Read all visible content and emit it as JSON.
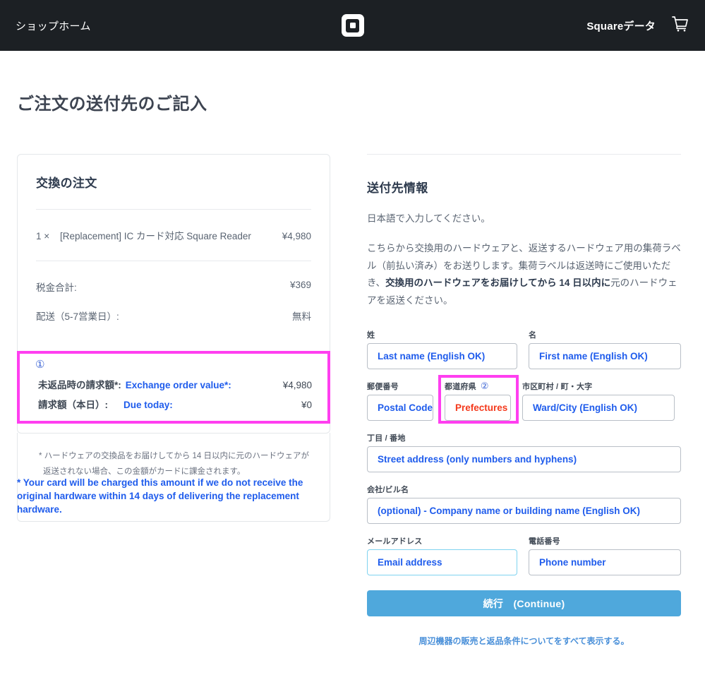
{
  "header": {
    "shop_home_label": "ショップホーム",
    "logo_name": "square-logo",
    "account_label": "Squareデータ",
    "cart_name": "cart-icon"
  },
  "page": {
    "title": "ご注文の送付先のご記入"
  },
  "order_summary": {
    "title": "交換の注文",
    "items": [
      {
        "qty": "1 ×",
        "name": "[Replacement] IC カード対応 Square Reader",
        "price": "¥4,980"
      }
    ],
    "totals": [
      {
        "label": "税金合計:",
        "value": "¥369"
      },
      {
        "label": "配送（5-7営業日）:",
        "value": "無料"
      }
    ],
    "highlight": {
      "marker": "①",
      "rows": [
        {
          "label_jp": "未返品時の請求額*:",
          "label_en": "Exchange order value*:",
          "amount": "¥4,980"
        },
        {
          "label_jp": "請求額（本日）:",
          "label_en": "Due today:",
          "amount": "¥0"
        }
      ]
    },
    "footnote_jp": "* ハードウェアの交換品をお届けしてから 14 日以内に元のハードウェアが返送されない場合、この金額がカードに課金されます。",
    "footnote_en": "* Your card will be charged this amount if we do not receive the original hardware within 14 days of delivering the replacement hardware."
  },
  "shipping": {
    "section_title": "送付先情報",
    "note": "日本語で入力してください。",
    "paragraph_part1": "こちらから交換用のハードウェアと、返送するハードウェア用の集荷ラベル（前払い済み）をお送りします。集荷ラベルは返送時にご使用いただき、",
    "paragraph_bold": "交換用のハードウェアをお届けしてから 14 日以内に",
    "paragraph_part2": "元のハードウェアを返送ください。",
    "fields": {
      "last_name": {
        "label": "姓",
        "placeholder": "Last name (English OK)"
      },
      "first_name": {
        "label": "名",
        "placeholder": "First name (English OK)"
      },
      "postal_code": {
        "label": "郵便番号",
        "placeholder": "Postal Code"
      },
      "prefecture": {
        "label": "都道府県",
        "marker": "②",
        "placeholder": "Prefectures"
      },
      "ward_city": {
        "label": "市区町村 / 町・大字",
        "placeholder": "Ward/City (English OK)"
      },
      "street": {
        "label": "丁目 / 番地",
        "placeholder": "Street address (only numbers and hyphens)"
      },
      "company": {
        "label": "会社/ビル名",
        "placeholder": "(optional) - Company name or building name (English OK)"
      },
      "email": {
        "label": "メールアドレス",
        "placeholder": "Email address"
      },
      "phone": {
        "label": "電話番号",
        "placeholder": "Phone number"
      }
    },
    "continue_button": "続行　(Continue)",
    "terms_link": "周辺機器の販売と返品条件についてをすべて表示する。"
  },
  "colors": {
    "header_bg": "#1c2024",
    "highlight_magenta": "#ff3ff0",
    "annotation_blue": "#1f5cec",
    "marker_blue": "#3b64d4",
    "red_text": "#f4391c",
    "button_blue": "#4fa8dc",
    "link_blue": "#4a90d9"
  }
}
